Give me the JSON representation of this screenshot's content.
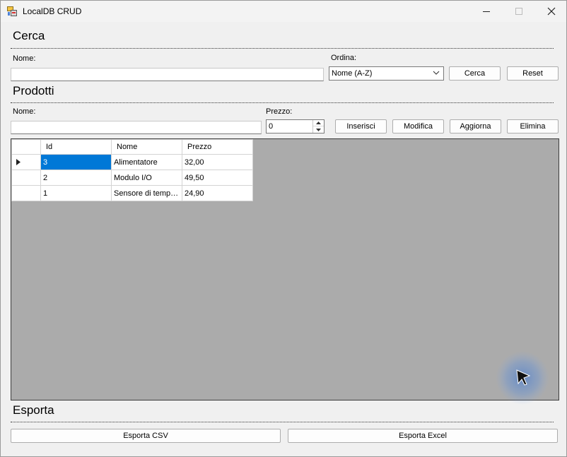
{
  "window": {
    "title": "LocalDB CRUD"
  },
  "search": {
    "heading": "Cerca",
    "name_label": "Nome:",
    "name_value": "",
    "sort_label": "Ordina:",
    "sort_selected": "Nome (A-Z)",
    "search_button": "Cerca",
    "reset_button": "Reset"
  },
  "products": {
    "heading": "Prodotti",
    "name_label": "Nome:",
    "name_value": "",
    "price_label": "Prezzo:",
    "price_value": "0",
    "insert_button": "Inserisci",
    "edit_button": "Modifica",
    "update_button": "Aggiorna",
    "delete_button": "Elimina"
  },
  "grid": {
    "columns": [
      "Id",
      "Nome",
      "Prezzo"
    ],
    "rows": [
      {
        "id": "3",
        "nome": "Alimentatore",
        "prezzo": "32,00"
      },
      {
        "id": "2",
        "nome": "Modulo I/O",
        "prezzo": "49,50"
      },
      {
        "id": "1",
        "nome": "Sensore di tempe...",
        "prezzo": "24,90"
      }
    ]
  },
  "export": {
    "heading": "Esporta",
    "csv_button": "Esporta CSV",
    "excel_button": "Esporta Excel"
  },
  "colors": {
    "selection": "#0078d7",
    "grid_background": "#ababab",
    "window_background": "#f0f0f0"
  }
}
